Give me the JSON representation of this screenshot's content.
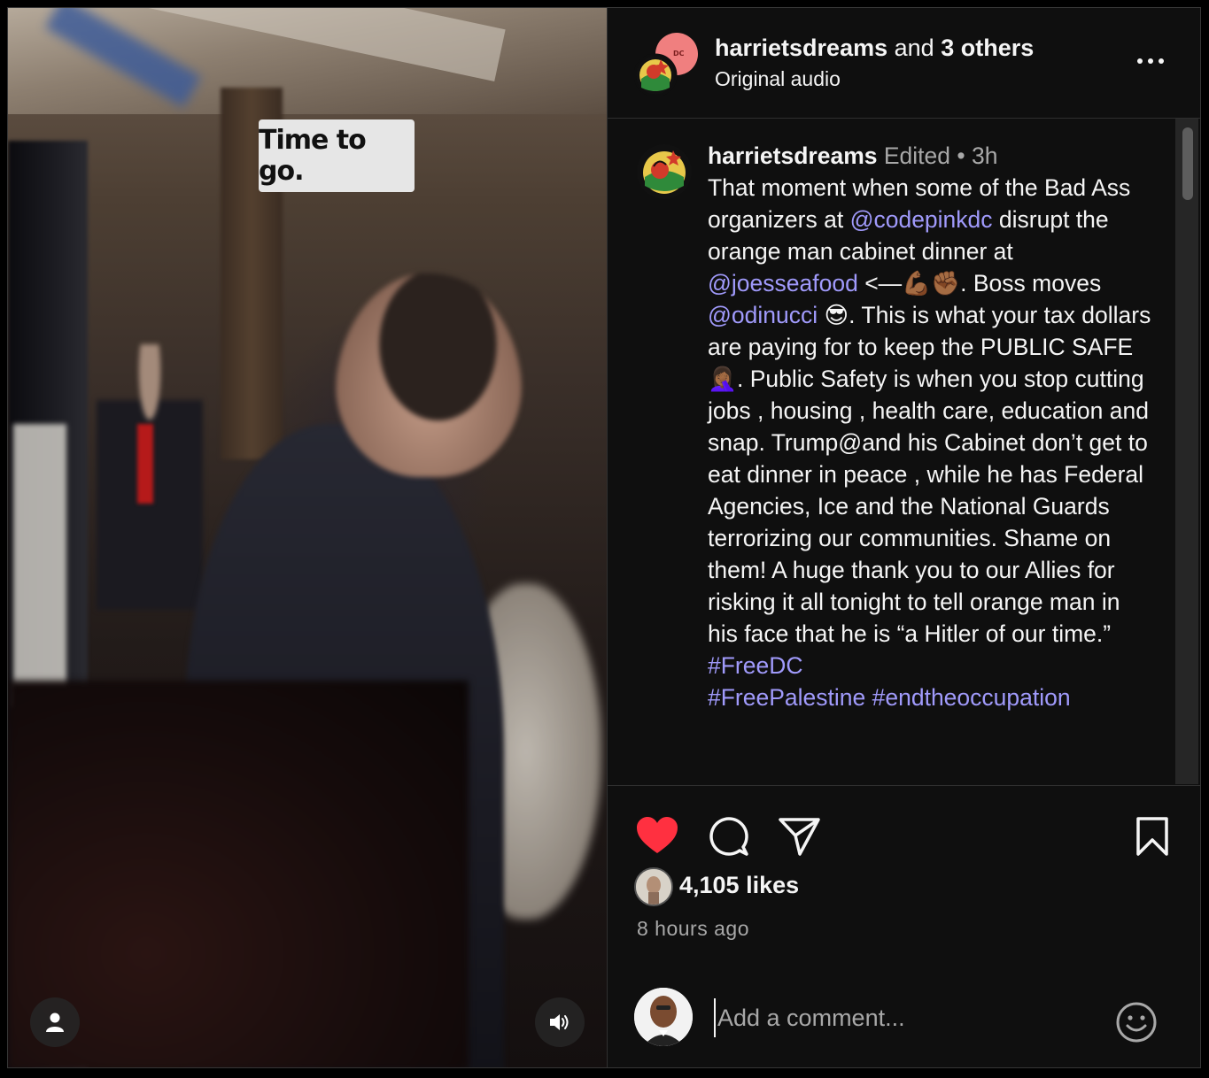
{
  "video": {
    "sticker_text": "Time to go.",
    "user_icon": "person-icon",
    "audio_icon": "speaker-icon"
  },
  "header": {
    "username": "harrietsdreams",
    "and_text": "and",
    "others": "3 others",
    "audio": "Original audio",
    "more_icon": "more-horizontal-icon"
  },
  "caption": {
    "username": "harrietsdreams",
    "edited": "Edited",
    "dot": "•",
    "time": "3h",
    "t1": "That moment when some of the Bad Ass organizers at ",
    "m1": "@codepinkdc",
    "t2": " disrupt the orange man cabinet dinner at ",
    "m2": "@joesseafood",
    "t3": " <—💪🏾✊🏾. Boss moves ",
    "m3": "@odinucci",
    "t4": " 😎. This is what your tax dollars are paying for to keep the PUBLIC SAFE 🤦🏾‍♀️. Public Safety is when you stop cutting jobs , housing , health care, education and snap. Trump@and his Cabinet don’t get to eat dinner in peace , while he has Federal Agencies, Ice and the National Guards terrorizing our communities. Shame on them! A huge thank you to our Allies for risking it all tonight to tell orange man in his face that he is “a Hitler of our time.” ",
    "h1": "#FreeDC",
    "h2": "#FreePalestine",
    "h3": "#endtheoccupation"
  },
  "actions": {
    "like_icon": "heart-icon",
    "comment_icon": "comment-icon",
    "share_icon": "share-icon",
    "save_icon": "bookmark-icon",
    "likes": "4,105 likes",
    "time_ago": "8 hours ago",
    "like_color": "#ff3040"
  },
  "comment": {
    "placeholder": "Add a comment...",
    "emoji_icon": "emoji-icon"
  },
  "colors": {
    "accent_link": "#a09afb",
    "background": "#0f0f0f",
    "muted": "#a8a8a8"
  }
}
